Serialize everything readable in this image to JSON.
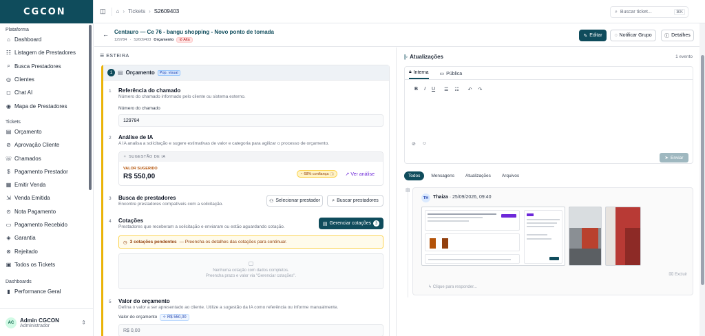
{
  "app": {
    "logo": "CGCON"
  },
  "sidebar": {
    "sections": [
      {
        "title": "Plataforma",
        "items": [
          {
            "label": "Dashboard",
            "icon": "⌂"
          },
          {
            "label": "Listagem de Prestadores",
            "icon": "☷"
          },
          {
            "label": "Busca Prestadores",
            "icon": "⌕"
          },
          {
            "label": "Clientes",
            "icon": "◎"
          },
          {
            "label": "Chat AI",
            "icon": "◻"
          },
          {
            "label": "Mapa de Prestadores",
            "icon": "◉"
          }
        ]
      },
      {
        "title": "Tickets",
        "items": [
          {
            "label": "Orçamento",
            "icon": "▤"
          },
          {
            "label": "Aprovação Cliente",
            "icon": "⊘"
          },
          {
            "label": "Chamados",
            "icon": "☏"
          },
          {
            "label": "Pagamento Prestador",
            "icon": "$"
          },
          {
            "label": "Emitir Venda",
            "icon": "▦"
          },
          {
            "label": "Venda Emitida",
            "icon": "⇲"
          },
          {
            "label": "Nota Pagamento",
            "icon": "⊙"
          },
          {
            "label": "Pagamento Recebido",
            "icon": "▭"
          },
          {
            "label": "Garantia",
            "icon": "◈"
          },
          {
            "label": "Rejeitado",
            "icon": "⊗"
          },
          {
            "label": "Todos os Tickets",
            "icon": "▣"
          }
        ]
      },
      {
        "title": "Dashboards",
        "items": [
          {
            "label": "Performance Geral",
            "icon": "▮"
          }
        ]
      }
    ],
    "user": {
      "initials": "AC",
      "name": "Admin CGCON",
      "role": "Administrador"
    }
  },
  "topbar": {
    "crumb_home": "⌂",
    "crumb_tickets": "Tickets",
    "crumb_current": "S2609403",
    "search_placeholder": "Buscar ticket...",
    "search_kbd": "⌘K"
  },
  "ticket": {
    "title": "Centauro — Ce 76 - bangu shopping - Novo ponto de tomada",
    "ref": "129784",
    "code": "S2609403",
    "stage": "Orçamento",
    "priority": "Alta",
    "actions": {
      "edit": "Editar",
      "notify": "Notificar Grupo",
      "details": "Detalhes"
    }
  },
  "pipeline": {
    "label": "ESTEIRA",
    "step_number": "1",
    "step_title": "Orçamento",
    "step_tag": "Pop. visual",
    "sections": {
      "ref": {
        "num": "1",
        "title": "Referência do chamado",
        "desc": "Número do chamado informado pelo cliente ou sistema externo.",
        "field_label": "Número do chamado",
        "value": "129784"
      },
      "ai": {
        "num": "2",
        "title": "Análise de IA",
        "desc": "A IA analisa a solicitação e sugere estimativas de valor e categoria para agilizar o processo de orçamento.",
        "box_title": "SUGESTÃO DE IA",
        "value_label": "VALOR SUGERIDO",
        "value": "R$ 550,00",
        "confidence": "68% confiança",
        "view": "Ver análise"
      },
      "search": {
        "num": "3",
        "title": "Busca de prestadores",
        "desc": "Encontre prestadores compatíveis com a solicitação.",
        "select_btn": "Selecionar prestador",
        "search_btn": "Buscar prestadores"
      },
      "quotes": {
        "num": "4",
        "title": "Cotações",
        "desc": "Prestadores que receberam a solicitação e enviaram ou estão aguardando cotação.",
        "manage_btn": "Gerenciar cotações",
        "manage_count": "3",
        "warning_strong": "3 cotações pendentes",
        "warning_rest": "— Preencha os detalhes das cotações para continuar.",
        "empty_line1": "Nenhuma cotação com dados completos.",
        "empty_line2": "Preencha prazo e valor via \"Gerenciar cotações\"."
      },
      "value": {
        "num": "5",
        "title": "Valor do orçamento",
        "desc": "Defina o valor a ser apresentado ao cliente. Utilize a sugestão da IA como referência ou informe manualmente.",
        "field_label": "Valor do orçamento",
        "chip": "R$ 550,00",
        "placeholder": "R$  0,00"
      }
    }
  },
  "updates": {
    "title": "Atualizações",
    "count": "1 evento",
    "tab_internal": "Interna",
    "tab_public": "Pública",
    "toolbar": [
      "B",
      "I",
      "U",
      "☰",
      "☷",
      "↶",
      "↷"
    ],
    "send": "Enviar",
    "filters": [
      "Todos",
      "Mensagens",
      "Atualizações",
      "Arquivos"
    ],
    "entry": {
      "initials": "TH",
      "author": "Thaiza",
      "datetime": "· 25/09/2026, 09:40",
      "delete": "Excluir",
      "reply": "Clique para responder..."
    }
  }
}
